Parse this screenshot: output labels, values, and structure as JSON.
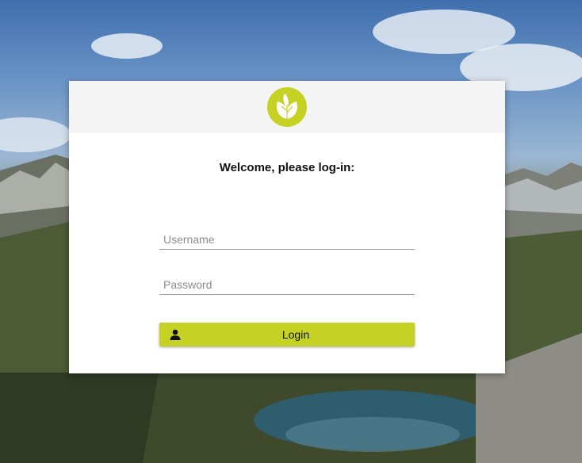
{
  "login": {
    "title": "Welcome, please log-in:",
    "username_placeholder": "Username",
    "password_placeholder": "Password",
    "login_label": "Login"
  },
  "icons": {
    "logo": "leaf-logo-icon",
    "login": "user-icon"
  },
  "colors": {
    "accent": "#c5d224",
    "card_header": "#f3f4f3"
  }
}
